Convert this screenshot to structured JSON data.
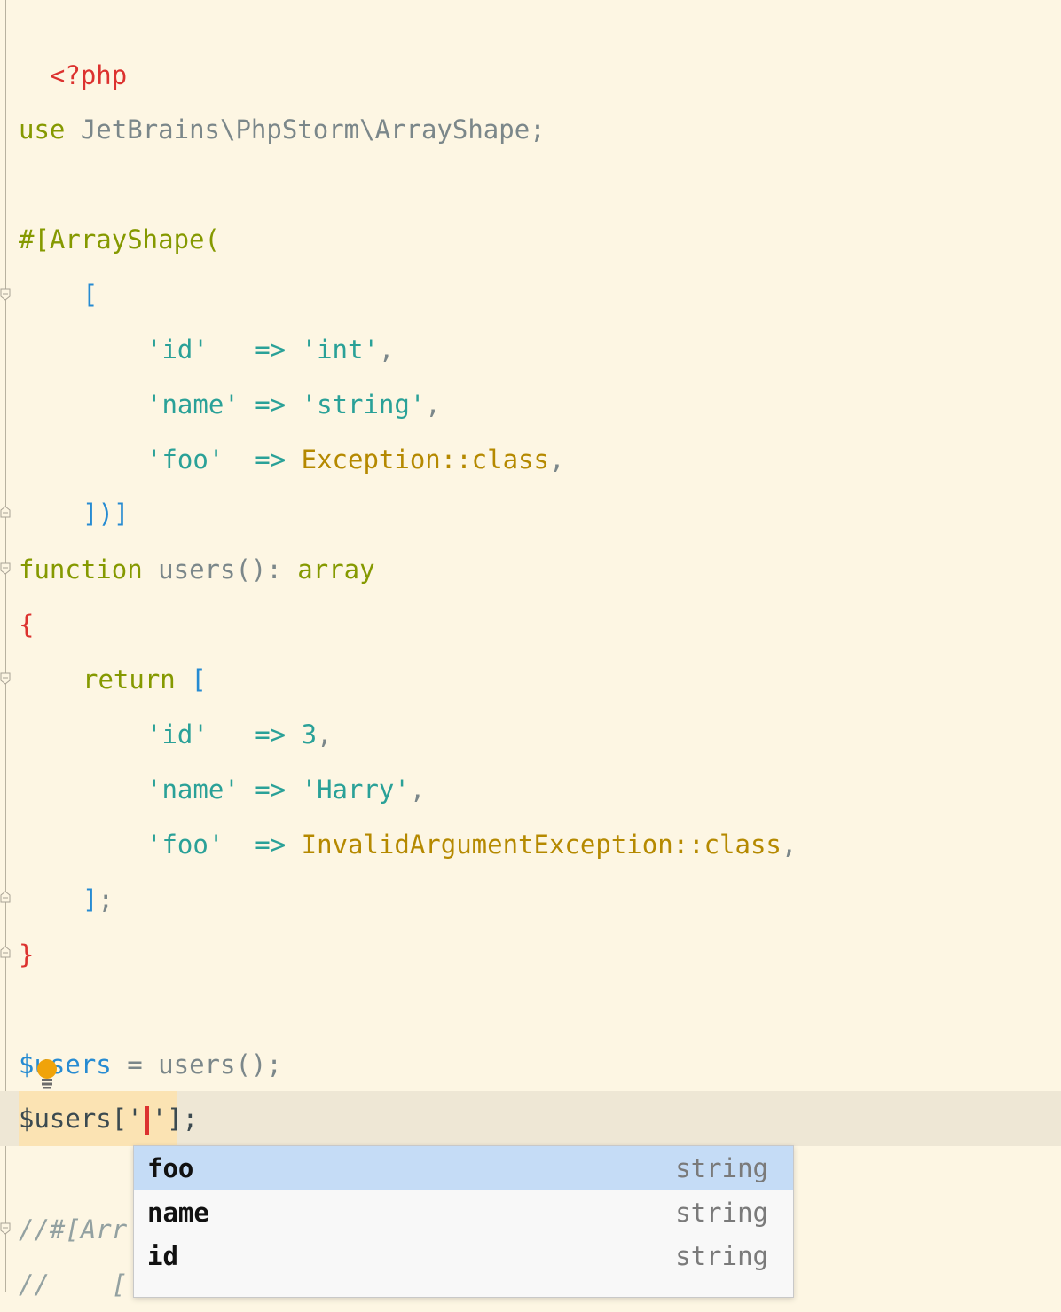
{
  "editor": {
    "lines": {
      "php_open": "<?php",
      "use_kw": "use",
      "use_ns": " JetBrains\\PhpStorm\\ArrayShape",
      "use_semi": ";",
      "attr_open": "#[ArrayShape(",
      "bracket_open": "[",
      "shape_id_key": "'id'",
      "shape_id_arrow": "   => ",
      "shape_id_val": "'int'",
      "shape_id_comma": ",",
      "shape_name_key": "'name'",
      "shape_name_arrow": " => ",
      "shape_name_val": "'string'",
      "shape_name_comma": ",",
      "shape_foo_key": "'foo'",
      "shape_foo_arrow": "  => ",
      "shape_foo_val": "Exception::class",
      "shape_foo_comma": ",",
      "attr_close": "])]",
      "fn_kw": "function",
      "fn_name": " users(): ",
      "fn_type": "array",
      "brace_open": "{",
      "return_kw": "return",
      "return_bracket": " [",
      "ret_id_key": "'id'",
      "ret_id_arrow": "   => ",
      "ret_id_val": "3",
      "ret_id_comma": ",",
      "ret_name_key": "'name'",
      "ret_name_arrow": " => ",
      "ret_name_val": "'Harry'",
      "ret_name_comma": ",",
      "ret_foo_key": "'foo'",
      "ret_foo_arrow": "  => ",
      "ret_foo_val": "InvalidArgumentException::class",
      "ret_foo_comma": ",",
      "ret_close": "]",
      "ret_close_semi": ";",
      "brace_close": "}",
      "assign_var": "$users",
      "assign_rest": " = users();",
      "access_prefix": "$users['",
      "access_suffix": "'];",
      "comment1": "//#[Arr",
      "comment2": "//    ["
    }
  },
  "completion_popup": {
    "items": [
      {
        "key": "foo",
        "type": "string",
        "selected": true
      },
      {
        "key": "name",
        "type": "string",
        "selected": false
      },
      {
        "key": "id",
        "type": "string",
        "selected": false
      }
    ]
  },
  "colors": {
    "background": "#fdf6e3",
    "keyword": "#859900",
    "string": "#2aa198",
    "class": "#b58900",
    "bracket": "#268bd2",
    "php_tag": "#dc322f",
    "selection": "#c5dcf6"
  }
}
